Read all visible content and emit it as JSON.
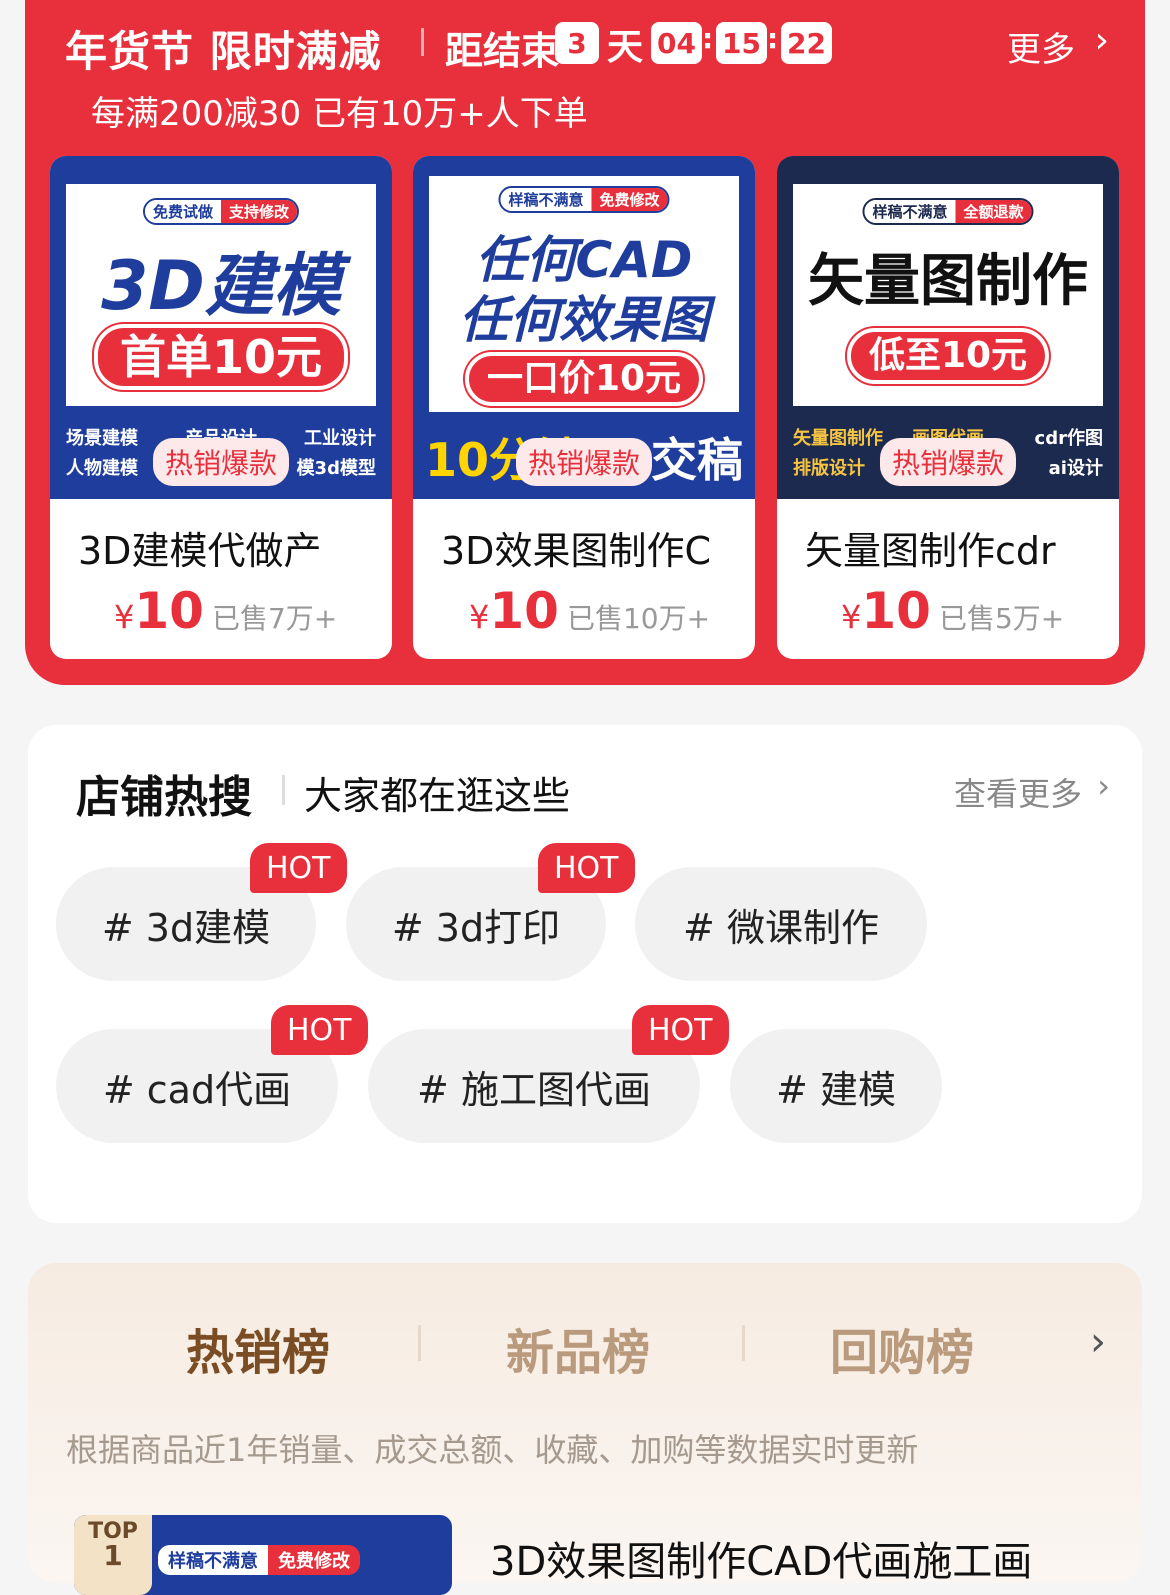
{
  "promo": {
    "title": "年货节 限时满减",
    "ends_label": "距结束",
    "countdown": {
      "days": "3",
      "day_unit": "天",
      "hours": "04",
      "minutes": "15",
      "seconds": "22"
    },
    "more_label": "更多",
    "subtitle": "每满200减30 已有10万+人下单",
    "products": [
      {
        "pill_a": "免费试做",
        "pill_b": "支持修改",
        "big_line1": "3D建模",
        "big_line2": "",
        "red_pill": "首单10元",
        "bottom": [
          "场景建模",
          "产品设计",
          "工业设计",
          "人物建模",
          "",
          "模3d模型"
        ],
        "hot_badge": "热销爆款",
        "title": "3D建模代做产",
        "price_symbol": "¥",
        "price": "10",
        "sold": "已售7万+"
      },
      {
        "pill_a": "样稿不满意",
        "pill_b": "免费修改",
        "big_line1": "任何CAD",
        "big_line2": "任何效果图",
        "red_pill": "一口价10元",
        "bottom": [
          "10分钟",
          "交稿"
        ],
        "hot_badge": "热销爆款",
        "title": "3D效果图制作C",
        "price_symbol": "¥",
        "price": "10",
        "sold": "已售10万+"
      },
      {
        "pill_a": "样稿不满意",
        "pill_b": "全额退款",
        "big_line1": "矢量图制作",
        "big_line2": "",
        "red_pill": "低至10元",
        "bottom": [
          "矢量图制作",
          "画图代画",
          "cdr作图",
          "排版设计",
          "",
          "ai设计"
        ],
        "hot_badge": "热销爆款",
        "title": "矢量图制作cdr",
        "price_symbol": "¥",
        "price": "10",
        "sold": "已售5万+"
      }
    ]
  },
  "hot_search": {
    "title": "店铺热搜",
    "subtitle": "大家都在逛这些",
    "more_label": "查看更多",
    "hot_label": "HOT",
    "tags": [
      {
        "label": "# 3d建模",
        "hot": true
      },
      {
        "label": "# 3d打印",
        "hot": true
      },
      {
        "label": "# 微课制作",
        "hot": false
      },
      {
        "label": "# cad代画",
        "hot": true
      },
      {
        "label": "# 施工图代画",
        "hot": true
      },
      {
        "label": "# 建模",
        "hot": false
      }
    ]
  },
  "ranking": {
    "tabs": [
      {
        "label": "热销榜",
        "active": true
      },
      {
        "label": "新品榜",
        "active": false
      },
      {
        "label": "回购榜",
        "active": false
      }
    ],
    "description": "根据商品近1年销量、成交总额、收藏、加购等数据实时更新",
    "top_item": {
      "badge": "TOP",
      "badge_num": "1",
      "pill_a": "样稿不满意",
      "pill_b": "免费修改",
      "title": "3D效果图制作CAD代画施工画"
    }
  },
  "colors": {
    "accent": "#e8303c",
    "blue": "#1f3d9c",
    "rank_active": "#7a4d25",
    "rank_inactive": "#b99a7c"
  }
}
